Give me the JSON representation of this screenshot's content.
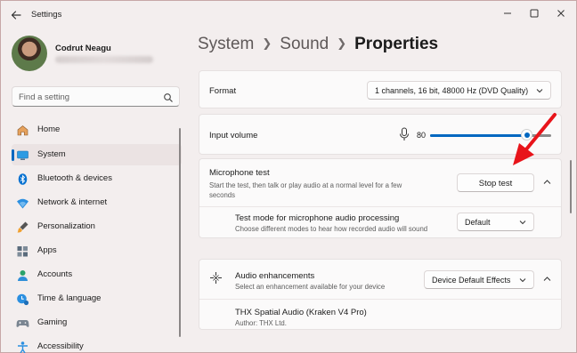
{
  "window": {
    "title": "Settings"
  },
  "user": {
    "name": "Codrut Neagu"
  },
  "search": {
    "placeholder": "Find a setting"
  },
  "sidebar": {
    "items": [
      {
        "label": "Home",
        "icon": "home-icon"
      },
      {
        "label": "System",
        "icon": "system-icon",
        "active": true
      },
      {
        "label": "Bluetooth & devices",
        "icon": "bluetooth-icon"
      },
      {
        "label": "Network & internet",
        "icon": "network-icon"
      },
      {
        "label": "Personalization",
        "icon": "personalization-icon"
      },
      {
        "label": "Apps",
        "icon": "apps-icon"
      },
      {
        "label": "Accounts",
        "icon": "accounts-icon"
      },
      {
        "label": "Time & language",
        "icon": "time-language-icon"
      },
      {
        "label": "Gaming",
        "icon": "gaming-icon"
      },
      {
        "label": "Accessibility",
        "icon": "accessibility-icon"
      }
    ]
  },
  "breadcrumb": {
    "level1": "System",
    "level2": "Sound",
    "current": "Properties"
  },
  "format": {
    "label": "Format",
    "value": "1 channels, 16 bit, 48000 Hz (DVD Quality)"
  },
  "input_volume": {
    "label": "Input volume",
    "value": "80",
    "fraction": 0.8
  },
  "mic_test": {
    "label": "Microphone test",
    "description": "Start the test, then talk or play audio at a normal level for a few seconds",
    "button": "Stop test"
  },
  "test_mode": {
    "label": "Test mode for microphone audio processing",
    "description": "Choose different modes to hear how recorded audio will sound",
    "value": "Default"
  },
  "enhancements": {
    "label": "Audio enhancements",
    "description": "Select an enhancement available for your device",
    "value": "Device Default Effects"
  },
  "thx": {
    "label": "THX Spatial Audio (Kraken V4 Pro)",
    "author": "Author: THX Ltd."
  },
  "colors": {
    "accent": "#0067c0",
    "annotation_arrow": "#e8141a"
  }
}
